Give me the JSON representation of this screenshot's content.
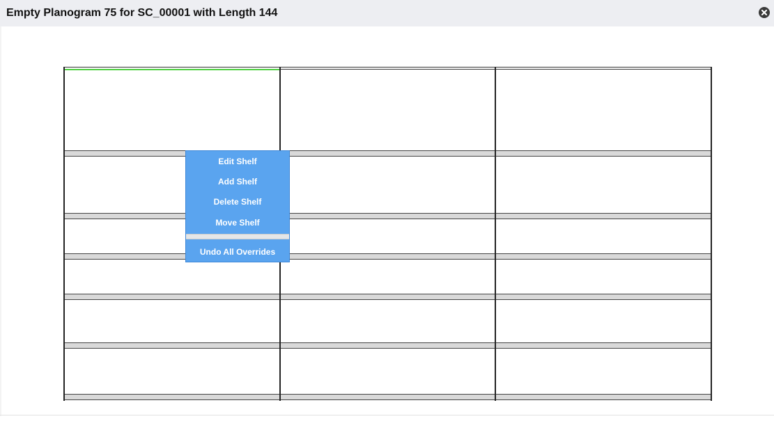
{
  "dialog": {
    "title": "Empty Planogram 75 for SC_00001 with Length 144",
    "close_icon": "close-circle-icon"
  },
  "planogram": {
    "columns": 3,
    "shelf_rows": 6,
    "selected_cell": {
      "row": 1,
      "column": 1
    },
    "colors": {
      "shelf_fill": "#d9d9d9",
      "selection_border": "#4ccf3f",
      "menu_background": "#5aa4ef"
    }
  },
  "context_menu": {
    "items": [
      "Edit Shelf",
      "Add Shelf",
      "Delete Shelf",
      "Move Shelf"
    ],
    "footer_item": "Undo All Overrides"
  }
}
